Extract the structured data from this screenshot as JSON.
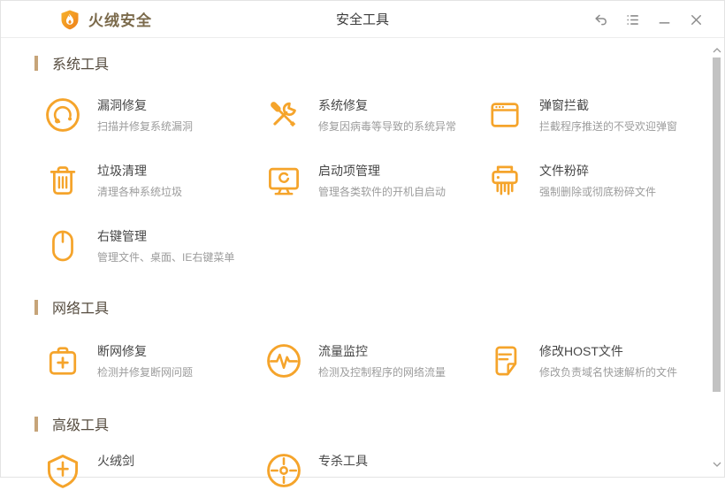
{
  "window": {
    "app_name": "火绒安全",
    "title": "安全工具"
  },
  "titlebar": {
    "icons": [
      "back-arrow",
      "menu-list",
      "minimize",
      "close"
    ]
  },
  "colors": {
    "accent_orange": "#F5A42B",
    "section_bar": "#C6A479",
    "section_text": "#564C3F",
    "tool_title": "#474747",
    "tool_desc": "#9C9C9C",
    "logo_text": "#7B6A4B"
  },
  "sections": [
    {
      "title": "系统工具",
      "tools": [
        {
          "name": "漏洞修复",
          "desc": "扫描并修复系统漏洞",
          "icon": "vulnerability-fix"
        },
        {
          "name": "系统修复",
          "desc": "修复因病毒等导致的系统异常",
          "icon": "system-repair"
        },
        {
          "name": "弹窗拦截",
          "desc": "拦截程序推送的不受欢迎弹窗",
          "icon": "popup-block"
        },
        {
          "name": "垃圾清理",
          "desc": "清理各种系统垃圾",
          "icon": "trash-clean"
        },
        {
          "name": "启动项管理",
          "desc": "管理各类软件的开机自启动",
          "icon": "startup-manager"
        },
        {
          "name": "文件粉碎",
          "desc": "强制删除或彻底粉碎文件",
          "icon": "file-shredder"
        },
        {
          "name": "右键管理",
          "desc": "管理文件、桌面、IE右键菜单",
          "icon": "context-menu"
        }
      ]
    },
    {
      "title": "网络工具",
      "tools": [
        {
          "name": "断网修复",
          "desc": "检测并修复断网问题",
          "icon": "network-repair"
        },
        {
          "name": "流量监控",
          "desc": "检测及控制程序的网络流量",
          "icon": "traffic-monitor"
        },
        {
          "name": "修改HOST文件",
          "desc": "修改负责域名快速解析的文件",
          "icon": "host-file"
        }
      ]
    },
    {
      "title": "高级工具",
      "tools": [
        {
          "name": "火绒剑",
          "desc": "",
          "icon": "huorong-sword"
        },
        {
          "name": "专杀工具",
          "desc": "",
          "icon": "special-kill"
        }
      ]
    }
  ]
}
